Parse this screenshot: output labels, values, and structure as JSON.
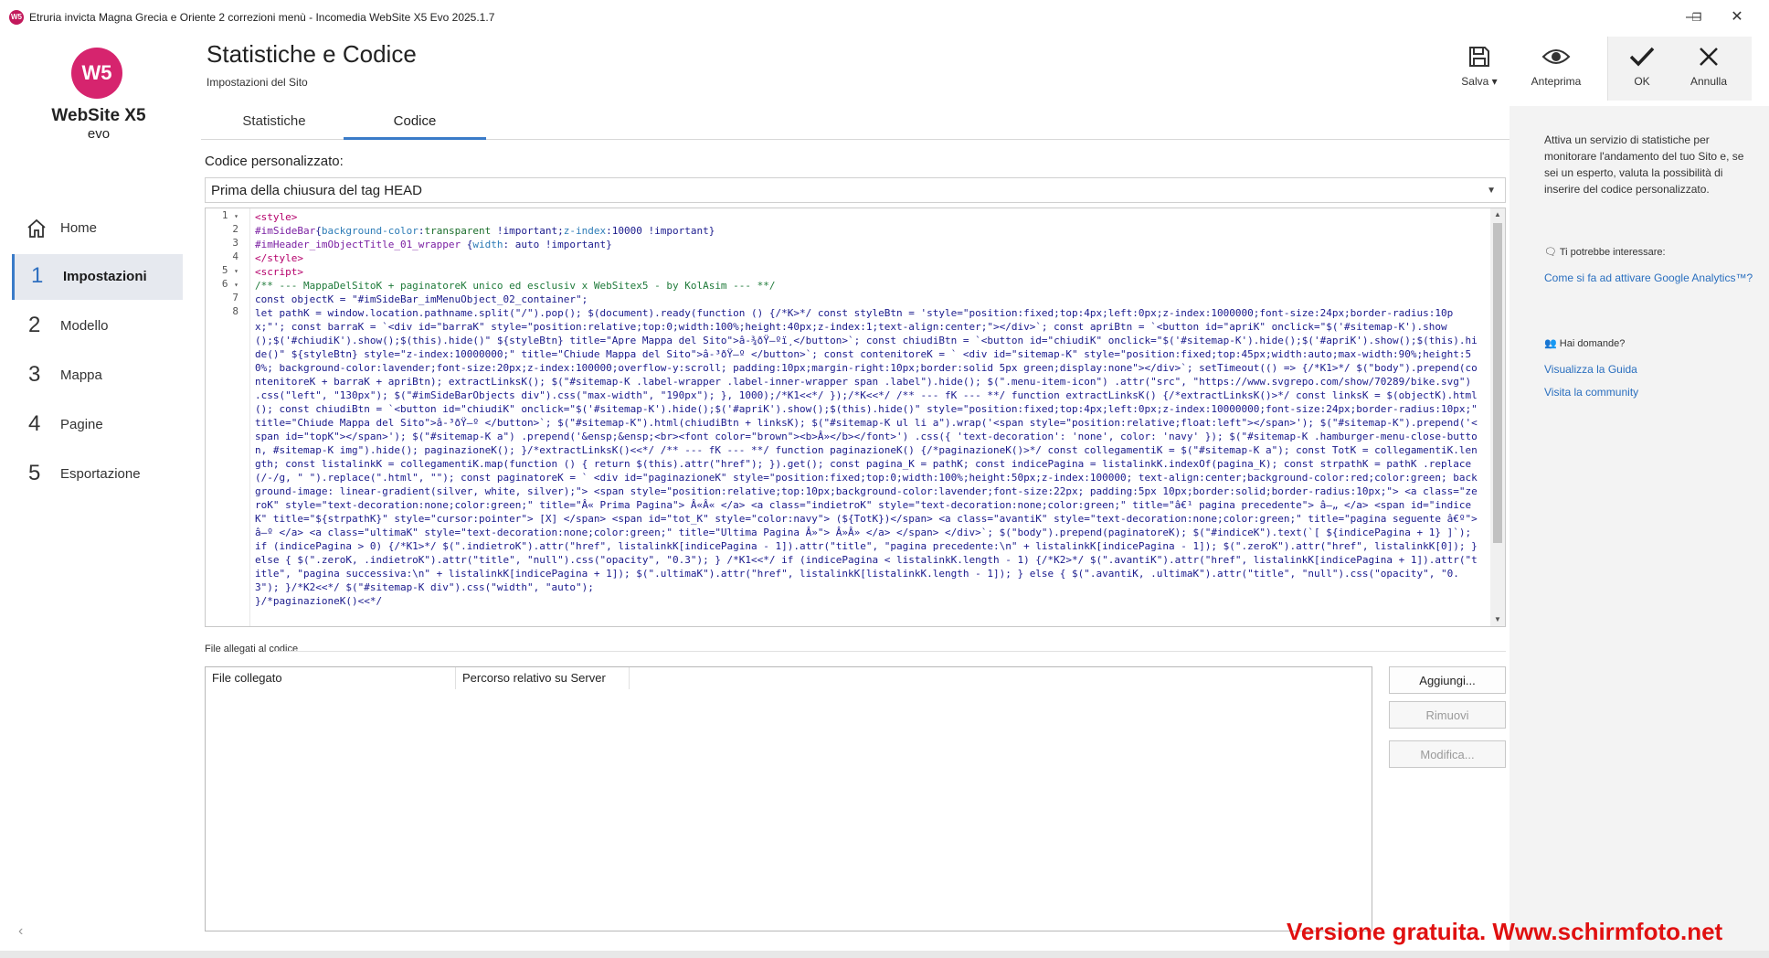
{
  "window": {
    "title": "Etruria invicta Magna Grecia e Oriente 2 correzioni menù - Incomedia WebSite X5 Evo 2025.1.7",
    "app_icon_text": "W5",
    "minimize_label": "—",
    "maximize_label": "❐",
    "close_label": "✕"
  },
  "logo": {
    "mark": "W5",
    "name": "WebSite X5",
    "sub": "evo"
  },
  "nav": {
    "items": [
      {
        "num": "",
        "label": "Home",
        "icon": "home-icon"
      },
      {
        "num": "1",
        "label": "Impostazioni"
      },
      {
        "num": "2",
        "label": "Modello"
      },
      {
        "num": "3",
        "label": "Mappa"
      },
      {
        "num": "4",
        "label": "Pagine"
      },
      {
        "num": "5",
        "label": "Esportazione"
      }
    ],
    "active_index": 1,
    "collapse_glyph": "‹"
  },
  "header": {
    "title": "Statistiche e Codice",
    "subtitle": "Impostazioni del Sito"
  },
  "toolbar": {
    "save": "Salva",
    "preview": "Anteprima",
    "ok": "OK",
    "cancel": "Annulla"
  },
  "tabs": [
    {
      "label": "Statistiche"
    },
    {
      "label": "Codice"
    }
  ],
  "active_tab": 1,
  "custom_code": {
    "label": "Codice personalizzato:",
    "position_selected": "Prima della chiusura del tag HEAD",
    "line_numbers": [
      "1",
      "2",
      "3",
      "4",
      "5",
      "6",
      "7",
      "8",
      "",
      "",
      "",
      "",
      "",
      "",
      "",
      "",
      "",
      "",
      "",
      "",
      "",
      "",
      "",
      "",
      "",
      "",
      "",
      "",
      "",
      "",
      ""
    ],
    "line_fold_markers": [
      "1",
      "5",
      "6"
    ]
  },
  "files": {
    "section_label": "File allegati al codice",
    "col_file": "File collegato",
    "col_path": "Percorso relativo su Server",
    "add": "Aggiungi...",
    "remove": "Rimuovi",
    "edit": "Modifica..."
  },
  "right_panel": {
    "description": "Attiva un servizio di statistiche per monitorare l'andamento del tuo Sito e, se sei un esperto, valuta la possibilità di inserire del codice personalizzato.",
    "interest_title": "Ti potrebbe interessare:",
    "interest_link": "Come si fa ad attivare Google Analytics™?",
    "questions_title": "Hai domande?",
    "guide_link": "Visualizza la Guida",
    "community_link": "Visita la community"
  },
  "watermark": "Versione gratuita. Www.schirmfoto.net",
  "colors": {
    "accent": "#3a7bc8",
    "brand": "#d6246e",
    "link": "#2a6fbf",
    "watermark": "#e01010"
  }
}
